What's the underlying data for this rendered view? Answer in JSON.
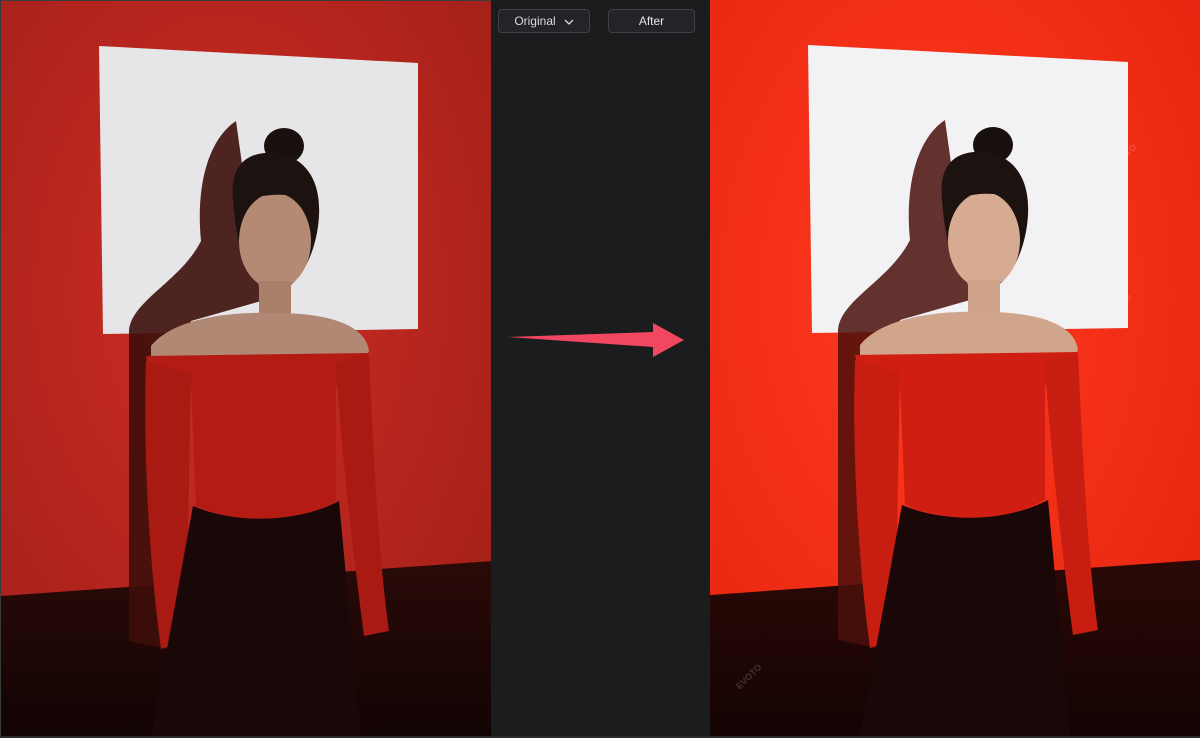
{
  "compare_mode": {
    "selected_option": "Original",
    "after_label": "After"
  },
  "panels": {
    "before": {
      "wall_color": "#c3281f",
      "floor_color": "#1a0605",
      "canvas_color": "#e8e8ea"
    },
    "after": {
      "wall_color": "#ee2a14",
      "floor_color": "#1a0605",
      "canvas_color": "#f2f2f4",
      "watermark_text": "EVOTO"
    }
  },
  "arrow": {
    "color": "#f24760",
    "icon": "arrow-right-icon"
  }
}
